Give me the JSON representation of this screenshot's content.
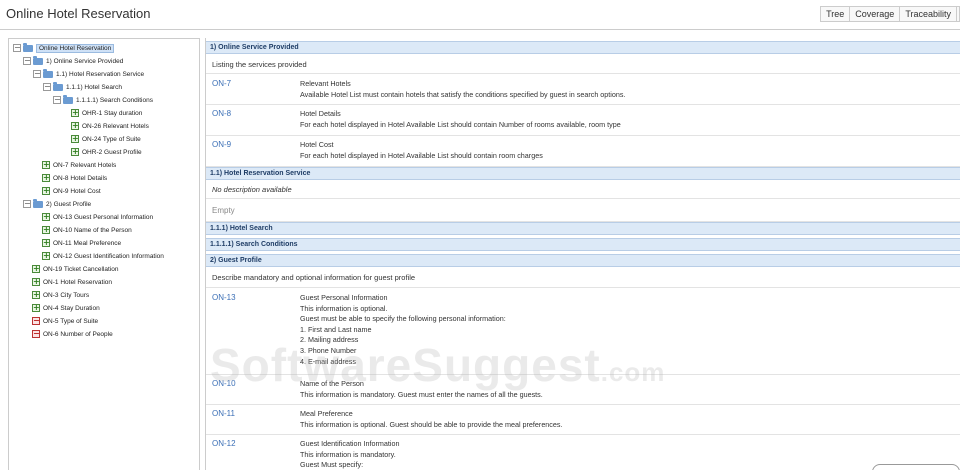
{
  "app": {
    "title": "Online Hotel Reservation"
  },
  "view_tabs": [
    "Tree",
    "Coverage",
    "Traceability"
  ],
  "tree": {
    "root": "Online Hotel Reservation",
    "n1": "1) Online Service Provided",
    "n11": "1.1) Hotel Reservation Service",
    "n111": "1.1.1) Hotel Search",
    "n1111": "1.1.1.1) Search Conditions",
    "ohr1": "OHR-1 Stay duration",
    "on26": "ON-26 Relevant Hotels",
    "on24": "ON-24 Type of Suite",
    "ohr2": "OHR-2 Guest Profile",
    "on7": "ON-7 Relevant Hotels",
    "on8": "ON-8 Hotel Details",
    "on9": "ON-9 Hotel Cost",
    "n2": "2) Guest Profile",
    "on13": "ON-13 Guest Personal Information",
    "on10": "ON-10 Name of the Person",
    "on11": "ON-11 Meal Preference",
    "on12": "ON-12 Guest Identification Information",
    "on19": "ON-19 Ticket Cancellation",
    "on1": "ON-1 Hotel Reservation",
    "on3": "ON-3 City Tours",
    "on4": "ON-4 Stay Duration",
    "on5": "ON-5 Type of Suite",
    "on6": "ON-6 Number of People"
  },
  "content": {
    "s1_header": "1) Online Service Provided",
    "s1_desc": "Listing the services provided",
    "on7": {
      "id": "ON-7",
      "title": "Relevant Hotels",
      "text": "Available Hotel List must contain hotels that satisfy the conditions specified by guest in search options."
    },
    "on8": {
      "id": "ON-8",
      "title": "Hotel Details",
      "text": "For each hotel displayed in Hotel Available List should contain Number of rooms available, room type"
    },
    "on9": {
      "id": "ON-9",
      "title": "Hotel Cost",
      "text": "For each hotel displayed in Hotel Available List should contain room charges"
    },
    "s11_header": "1.1) Hotel Reservation Service",
    "s11_desc": "No description available",
    "s11_empty": "Empty",
    "s111_header": "1.1.1) Hotel Search",
    "s1111_header": "1.1.1.1) Search Conditions",
    "s2_header": "2) Guest Profile",
    "s2_desc": "Describe mandatory and optional information for guest profile",
    "on13": {
      "id": "ON-13",
      "title": "Guest Personal Information",
      "l1": "This information is optional.",
      "l2": "Guest must be able to specify the following personal information:",
      "l3": "1. First and Last name",
      "l4": "2. Mailing address",
      "l5": "3. Phone Number",
      "l6": "4. E-mail address"
    },
    "on10": {
      "id": "ON-10",
      "title": "Name of the Person",
      "text": "This information is mandatory. Guest must enter the names of all the guests."
    },
    "on11": {
      "id": "ON-11",
      "title": "Meal Preference",
      "text": "This information is optional. Guest should be able to provide the meal preferences."
    },
    "on12": {
      "id": "ON-12",
      "title": "Guest Identification Information",
      "l1": "This information is mandatory.",
      "l2": "Guest Must specify:"
    }
  },
  "watermark": {
    "main": "SoftwareSuggest",
    "suffix": ".com"
  }
}
